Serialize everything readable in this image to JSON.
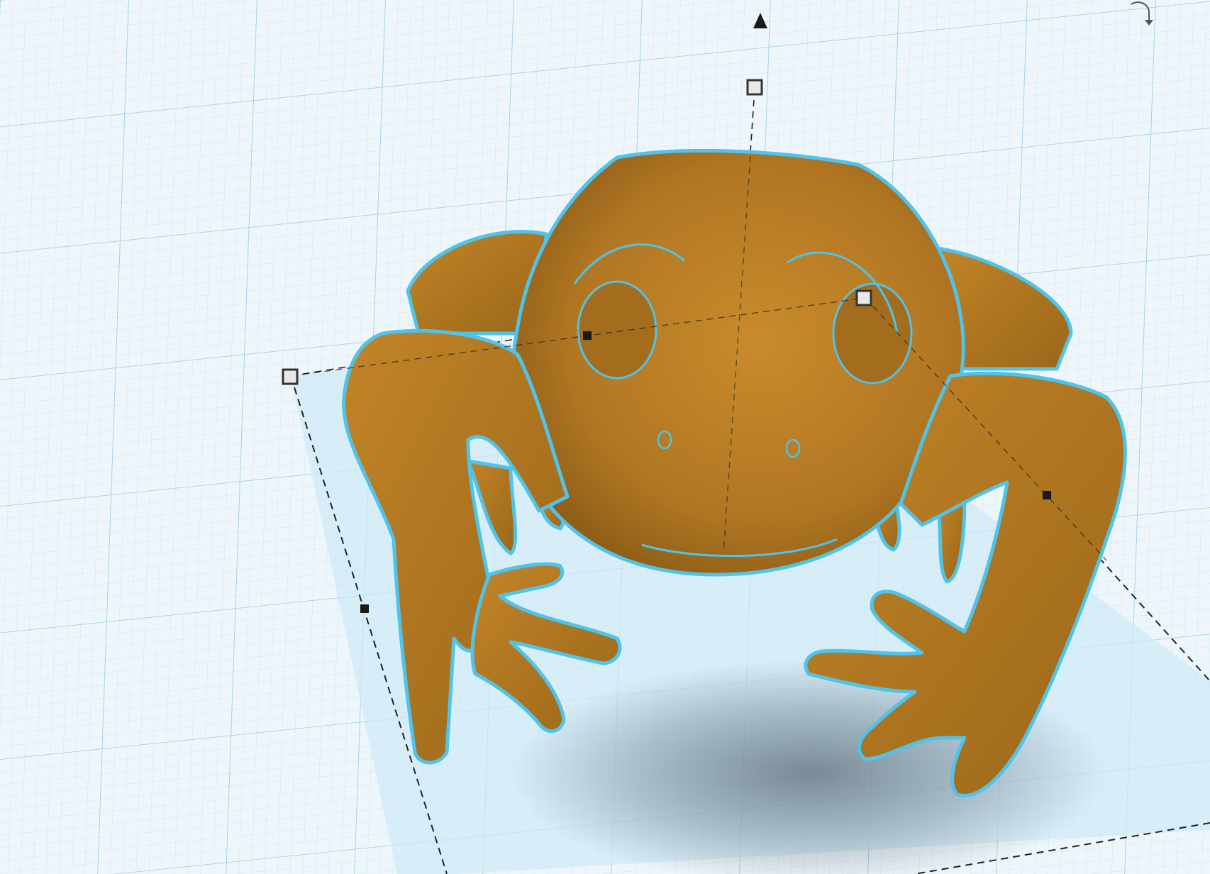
{
  "app": {
    "view": "3d-workplane-editor"
  },
  "colors": {
    "background": "#ffffff",
    "workplane": "#eef6fb",
    "grid_minor": "#cfe6f3",
    "grid_major": "#9ccbe6",
    "footprint_fill": "#cde9f6",
    "selection_outline": "#4fc3ea",
    "model_fill": "#b57a22",
    "model_shadow": "#8a5a16",
    "model_highlight": "#cf9133",
    "handle_fill": "#e8e8e8",
    "handle_stroke": "#333333",
    "dashed_line": "#222222"
  },
  "scene": {
    "model": {
      "name": "frog",
      "selected": true
    },
    "handles": [
      {
        "name": "height-handle-top",
        "kind": "white-square"
      },
      {
        "name": "corner-handle-left",
        "kind": "white-square"
      },
      {
        "name": "corner-handle-right",
        "kind": "white-square"
      },
      {
        "name": "edge-handle-left",
        "kind": "black-square"
      },
      {
        "name": "edge-handle-center-left",
        "kind": "black-square"
      },
      {
        "name": "edge-handle-right",
        "kind": "black-square"
      }
    ],
    "controls": {
      "lift_arrow_icon": "triangle-up-icon",
      "rotate_icon": "rotate-arrow-icon"
    }
  }
}
